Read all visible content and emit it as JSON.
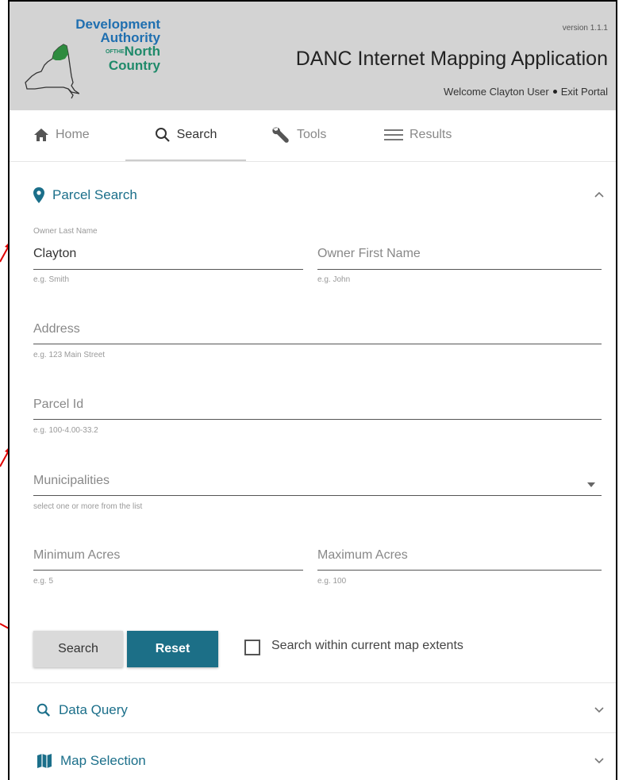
{
  "header": {
    "logo": {
      "line1": "Development",
      "line2": "Authority",
      "line3_of": "OF",
      "line3_the": "THE",
      "line3": "North",
      "line4": "Country"
    },
    "version": "version 1.1.1",
    "title": "DANC Internet Mapping Application",
    "welcome": "Welcome Clayton User",
    "exit": "Exit Portal"
  },
  "tabs": [
    {
      "label": "Home",
      "icon": "home-icon"
    },
    {
      "label": "Search",
      "icon": "search-icon"
    },
    {
      "label": "Tools",
      "icon": "wrench-icon"
    },
    {
      "label": "Results",
      "icon": "menu-icon"
    }
  ],
  "parcel_search": {
    "title": "Parcel Search",
    "owner_last": {
      "label": "Owner Last Name",
      "value": "Clayton",
      "hint": "e.g. Smith"
    },
    "owner_first": {
      "placeholder": "Owner First Name",
      "hint": "e.g. John"
    },
    "address": {
      "placeholder": "Address",
      "hint": "e.g. 123 Main Street"
    },
    "parcel_id": {
      "placeholder": "Parcel Id",
      "hint": "e.g. 100-4.00-33.2"
    },
    "municipalities": {
      "placeholder": "Municipalities",
      "hint": "select one or more from the list"
    },
    "min_acres": {
      "placeholder": "Minimum Acres",
      "hint": "e.g. 5"
    },
    "max_acres": {
      "placeholder": "Maximum Acres",
      "hint": "e.g. 100"
    },
    "search_button": "Search",
    "reset_button": "Reset",
    "extent_checkbox": "Search within current map extents"
  },
  "data_query": {
    "title": "Data Query"
  },
  "map_selection": {
    "title": "Map Selection"
  },
  "colors": {
    "accent": "#1c6f87",
    "header_bg": "#d3d3d3",
    "arrow": "#e00000"
  }
}
